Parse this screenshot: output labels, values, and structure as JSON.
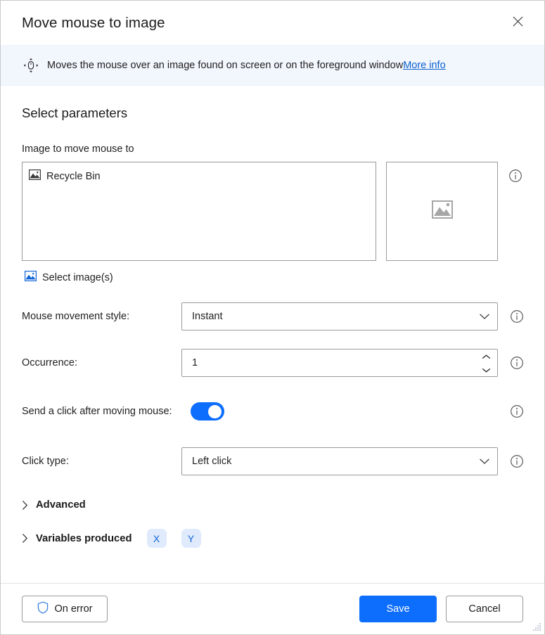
{
  "window": {
    "title": "Move mouse to image",
    "close_icon": "close-icon"
  },
  "banner": {
    "icon": "mouse-move-icon",
    "text": "Moves the mouse over an image found on screen or on the foreground window ",
    "link_label": "More info",
    "background": "#f2f6fd",
    "link_color": "#0b61cf"
  },
  "main": {
    "section_title": "Select parameters",
    "image_field": {
      "label": "Image to move mouse to",
      "items": [
        {
          "icon": "image-icon",
          "label": "Recycle Bin"
        }
      ],
      "preview_icon": "image-placeholder-icon",
      "info_icon": "info-icon"
    },
    "select_images": {
      "icon": "image-icon",
      "label": "Select image(s)"
    },
    "rows": [
      {
        "name": "mouse-movement-style",
        "label": "Mouse movement style:",
        "type": "combo",
        "value": "Instant",
        "info_icon": "info-icon"
      },
      {
        "name": "occurrence",
        "label": "Occurrence:",
        "type": "spinner",
        "value": "1",
        "info_icon": "info-icon"
      },
      {
        "name": "send-click-after-moving-mouse",
        "label": "Send a click after moving mouse:",
        "type": "toggle",
        "value": "on",
        "info_icon": "info-icon"
      },
      {
        "name": "click-type",
        "label": "Click type:",
        "type": "combo",
        "value": "Left click",
        "info_icon": "info-icon"
      }
    ],
    "advanced": {
      "label": "Advanced",
      "caret": "chevron-right-icon",
      "expanded": "false"
    },
    "variables_produced": {
      "label": "Variables produced",
      "caret": "chevron-right-icon",
      "expanded": "false",
      "chips": [
        "X",
        "Y"
      ],
      "chip_bg": "#dfeafc",
      "chip_color": "#1366d6"
    }
  },
  "footer": {
    "on_error_label": "On error",
    "on_error_icon": "shield-icon",
    "save_label": "Save",
    "cancel_label": "Cancel",
    "accent": "#0d6efd",
    "grip_icon": "resize-grip-icon"
  }
}
